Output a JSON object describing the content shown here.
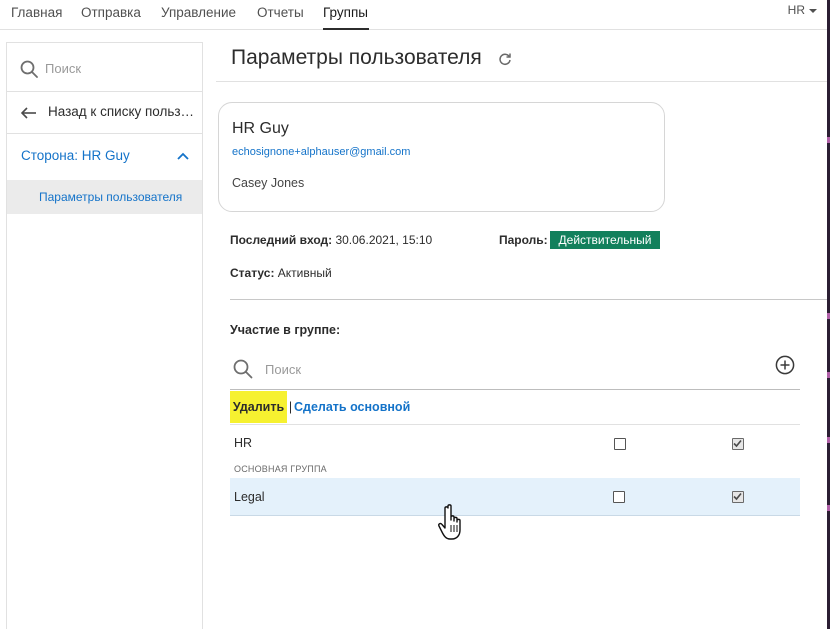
{
  "topnav": {
    "items": [
      "Главная",
      "Отправка",
      "Управление",
      "Отчеты",
      "Группы"
    ],
    "active": "Группы",
    "user_menu": "HR"
  },
  "sidebar": {
    "search_placeholder": "Поиск",
    "back_label": "Назад к списку пользователей",
    "party_label": "Сторона: HR Guy",
    "sub_item": "Параметры пользователя"
  },
  "main": {
    "title": "Параметры пользователя",
    "user": {
      "name": "HR Guy",
      "email": "echosignone+alphauser@gmail.com",
      "full_name": "Casey Jones"
    },
    "last_login_label": "Последний вход:",
    "last_login_value": "30.06.2021, 15:10",
    "password_label": "Пароль:",
    "password_status": "Действительный",
    "status_label": "Статус:",
    "status_value": "Активный",
    "group_section_title": "Участие в группе:",
    "group_search_placeholder": "Поиск",
    "actions": {
      "remove": "Удалить",
      "separator": "|",
      "make_primary": "Сделать основной"
    },
    "groups": [
      {
        "name": "HR",
        "col1_checked": false,
        "col2_checked": true,
        "selected": false
      },
      {
        "name": "Legal",
        "col1_checked": false,
        "col2_checked": true,
        "selected": true
      }
    ],
    "primary_group_label": "ОСНОВНАЯ ГРУППА"
  },
  "colors": {
    "link": "#1473c9",
    "valid_badge": "#12805c",
    "highlight": "#f6f130",
    "selected_row": "#e4f1fb"
  },
  "icons": [
    "search-icon",
    "arrow-left-icon",
    "chevron-up-icon",
    "refresh-icon",
    "add-circle-icon",
    "hand-cursor-icon",
    "checkmark-icon"
  ]
}
